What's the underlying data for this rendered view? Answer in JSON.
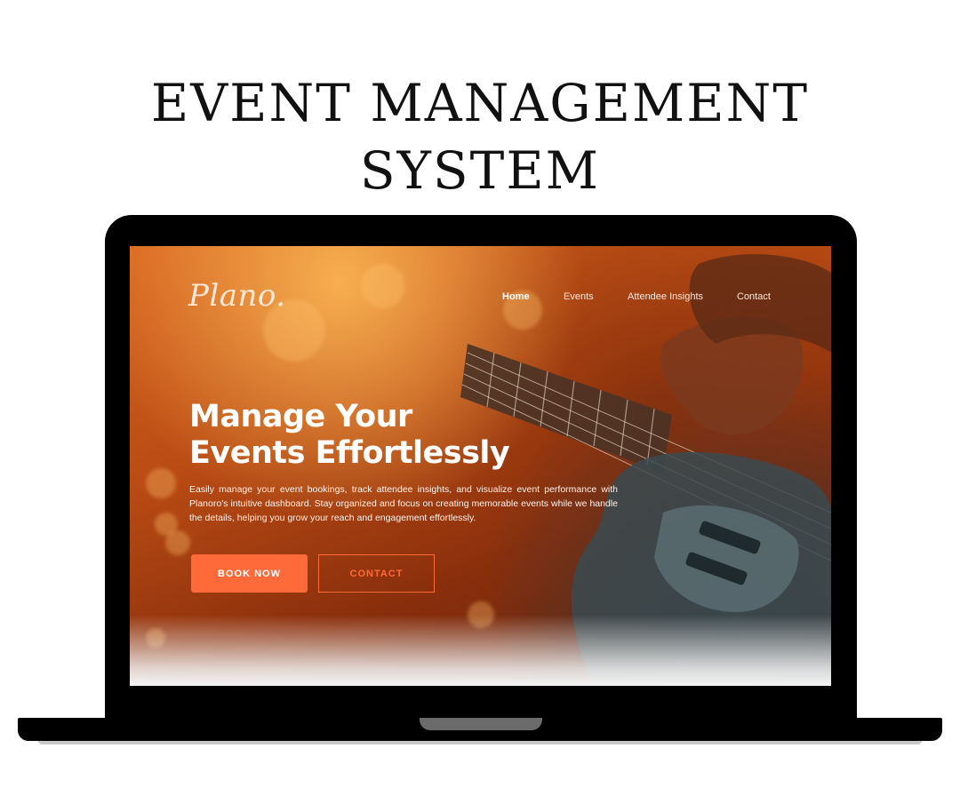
{
  "page": {
    "heading_line1": "EVENT MANAGEMENT",
    "heading_line2": "SYSTEM"
  },
  "site": {
    "logo": "Plano.",
    "nav": {
      "items": [
        {
          "label": "Home",
          "active": true
        },
        {
          "label": "Events",
          "active": false
        },
        {
          "label": "Attendee Insights",
          "active": false
        },
        {
          "label": "Contact",
          "active": false
        }
      ]
    },
    "hero": {
      "title_line1": "Manage Your",
      "title_line2": "Events Effortlessly",
      "description": "Easily manage your event bookings, track attendee insights, and visualize event performance with Planoro's intuitive dashboard. Stay organized and focus on creating memorable events while we handle the details, helping you grow your reach and engagement effortlessly.",
      "primary_button": "BOOK NOW",
      "secondary_button": "CONTACT"
    }
  },
  "colors": {
    "accent": "#ff6a3a",
    "text_light": "#ffffff",
    "page_background": "#ffffff",
    "device_frame": "#000000"
  }
}
